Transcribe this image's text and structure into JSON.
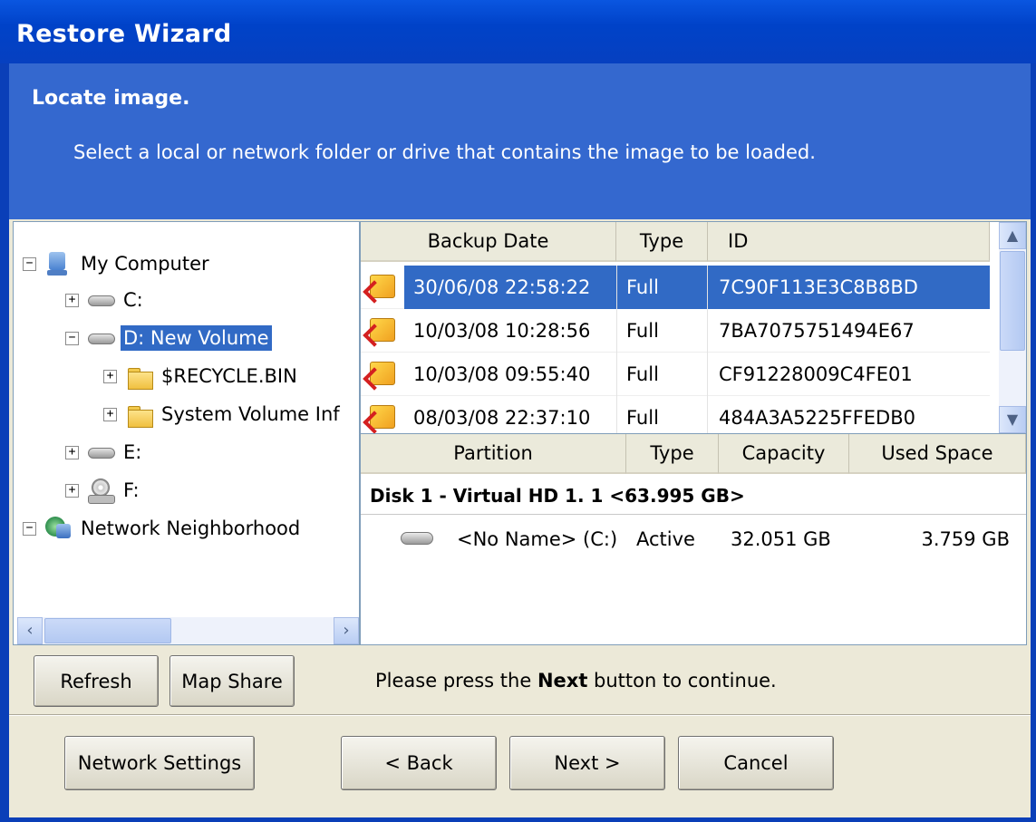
{
  "window": {
    "title": "Restore Wizard"
  },
  "header": {
    "title": "Locate image.",
    "subtitle": "Select a local or network folder or drive that contains the image to be loaded."
  },
  "tree": {
    "nodes": [
      {
        "label": "My Computer",
        "expander": "−",
        "icon": "computer-icon"
      },
      {
        "label": "C:",
        "expander": "+",
        "icon": "drive-icon"
      },
      {
        "label": "D: New Volume",
        "expander": "−",
        "icon": "drive-icon",
        "selected": true
      },
      {
        "label": "$RECYCLE.BIN",
        "expander": "+",
        "icon": "folder-icon"
      },
      {
        "label": "System Volume Inf",
        "expander": "+",
        "icon": "folder-icon"
      },
      {
        "label": "E:",
        "expander": "+",
        "icon": "drive-icon"
      },
      {
        "label": "F:",
        "expander": "+",
        "icon": "cdrom-icon"
      },
      {
        "label": "Network Neighborhood",
        "expander": "−",
        "icon": "network-icon"
      }
    ]
  },
  "backups": {
    "columns": [
      "Backup Date",
      "Type",
      "ID"
    ],
    "rows": [
      {
        "date": "30/06/08 22:58:22",
        "type": "Full",
        "id": "7C90F113E3C8B8BD",
        "selected": true
      },
      {
        "date": "10/03/08 10:28:56",
        "type": "Full",
        "id": "7BA7075751494E67"
      },
      {
        "date": "10/03/08 09:55:40",
        "type": "Full",
        "id": "CF91228009C4FE01"
      },
      {
        "date": "08/03/08 22:37:10",
        "type": "Full",
        "id": "484A3A5225FFEDB0"
      }
    ]
  },
  "partitions": {
    "columns": [
      "Partition",
      "Type",
      "Capacity",
      "Used Space"
    ],
    "disk": "Disk 1 - Virtual HD 1. 1  <63.995 GB>",
    "rows": [
      {
        "name": "<No Name> (C:)",
        "type": "Active",
        "capacity": "32.051 GB",
        "used": "3.759 GB"
      }
    ]
  },
  "actions": {
    "refresh": "Refresh",
    "map_share": "Map Share",
    "message_before": "Please press the ",
    "message_bold": "Next",
    "message_after": " button to continue."
  },
  "footer": {
    "network_settings": "Network Settings",
    "back": "< Back",
    "next": "Next >",
    "cancel": "Cancel"
  },
  "colors": {
    "titlebar": "#0a56e0",
    "header": "#3468cf",
    "selection": "#316ac5",
    "dialog": "#ece9d8"
  }
}
